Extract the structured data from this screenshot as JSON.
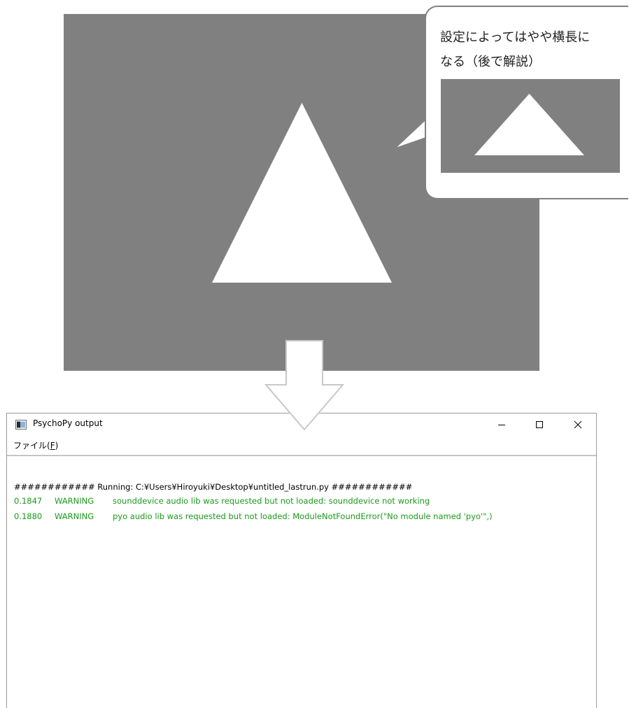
{
  "callout": {
    "text": "設定によってはやや横長に\nなる（後で解説）"
  },
  "window": {
    "title": "PsychoPy output",
    "menu": {
      "file_label": "ファイル(",
      "file_accel": "F",
      "file_close": ")"
    }
  },
  "log": {
    "running_line": "############ Running: C:¥Users¥Hiroyuki¥Desktop¥untitled_lastrun.py ############",
    "entries": [
      {
        "time": "0.1847",
        "level": "WARNING",
        "message": "sounddevice audio lib was requested but not loaded: sounddevice not working"
      },
      {
        "time": "0.1880",
        "level": "WARNING",
        "message": "pyo audio lib was requested but not loaded: ModuleNotFoundError(\"No module named 'pyo'\",)"
      }
    ]
  },
  "colors": {
    "stimulus_background": "#808080",
    "stimulus_shape": "#ffffff",
    "warning_text": "#1a9a1a"
  },
  "icons": {
    "app": "psychopy-app-icon",
    "minimize": "minimize-icon",
    "maximize": "maximize-icon",
    "close": "close-icon",
    "arrow": "down-arrow-icon"
  }
}
